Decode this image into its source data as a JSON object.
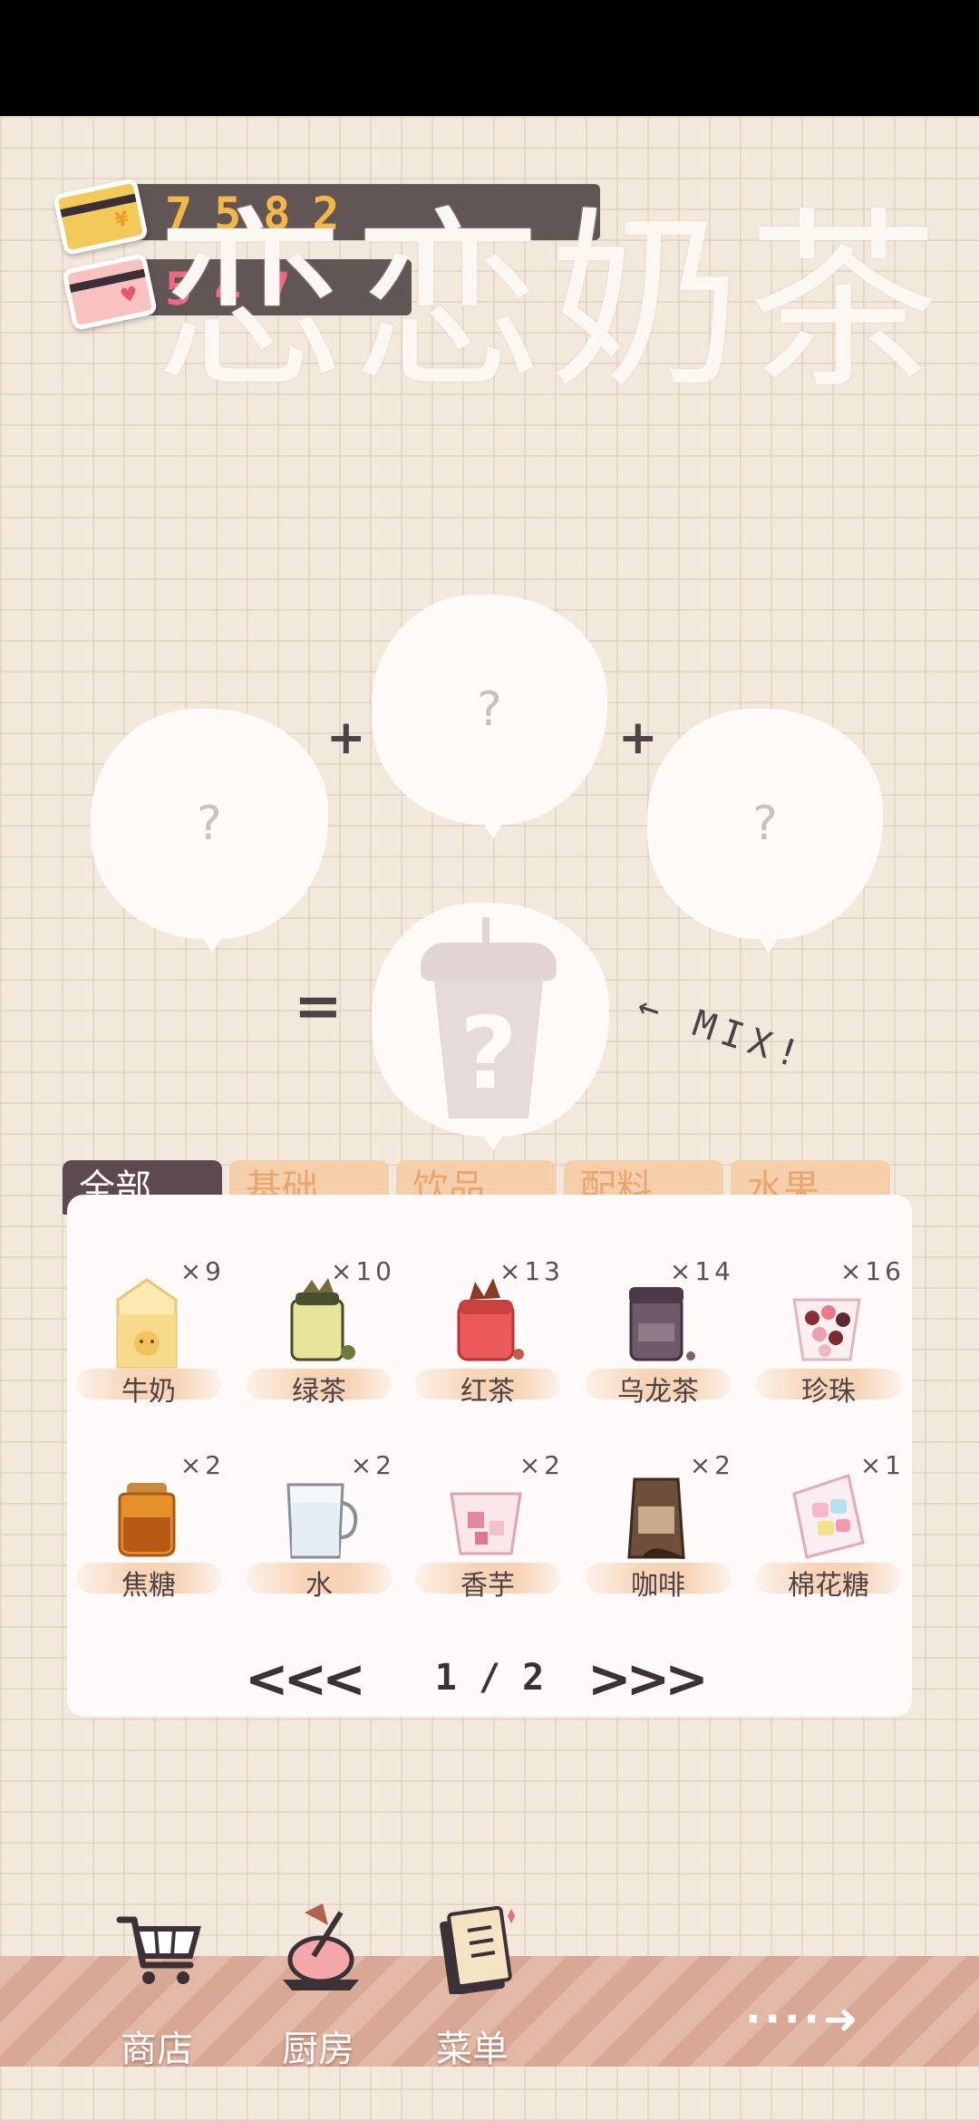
{
  "currency": {
    "coins": "7582",
    "hearts": "547",
    "coin_color": "#f2b64a",
    "heart_color": "#f06782"
  },
  "title": "恋恋奶茶",
  "mix_area": {
    "slot_placeholder": "?",
    "plus": "+",
    "equals": "=",
    "mix_label": "← MIX!"
  },
  "tabs": [
    {
      "label": "全部",
      "active": true
    },
    {
      "label": "基础",
      "active": false
    },
    {
      "label": "饮品",
      "active": false
    },
    {
      "label": "配料",
      "active": false
    },
    {
      "label": "水果",
      "active": false
    }
  ],
  "ingredients": [
    {
      "name": "牛奶",
      "count": "×9",
      "icon": "milk-carton-icon"
    },
    {
      "name": "绿茶",
      "count": "×10",
      "icon": "green-tea-jar-icon"
    },
    {
      "name": "红茶",
      "count": "×13",
      "icon": "black-tea-jar-icon"
    },
    {
      "name": "乌龙茶",
      "count": "×14",
      "icon": "oolong-tea-jar-icon"
    },
    {
      "name": "珍珠",
      "count": "×16",
      "icon": "pearls-cup-icon"
    },
    {
      "name": "焦糖",
      "count": "×2",
      "icon": "caramel-jar-icon"
    },
    {
      "name": "水",
      "count": "×2",
      "icon": "water-glass-icon"
    },
    {
      "name": "香芋",
      "count": "×2",
      "icon": "taro-cup-icon"
    },
    {
      "name": "咖啡",
      "count": "×2",
      "icon": "coffee-bag-icon"
    },
    {
      "name": "棉花糖",
      "count": "×1",
      "icon": "marshmallow-bag-icon"
    }
  ],
  "pager": {
    "prev": "<<<",
    "next": ">>>",
    "label": "1 / 2"
  },
  "nav": [
    {
      "label": "商店",
      "icon": "shopping-cart-icon"
    },
    {
      "label": "厨房",
      "icon": "kitchen-pot-icon"
    },
    {
      "label": "菜单",
      "icon": "menu-book-icon"
    }
  ],
  "next_label": "····➜"
}
